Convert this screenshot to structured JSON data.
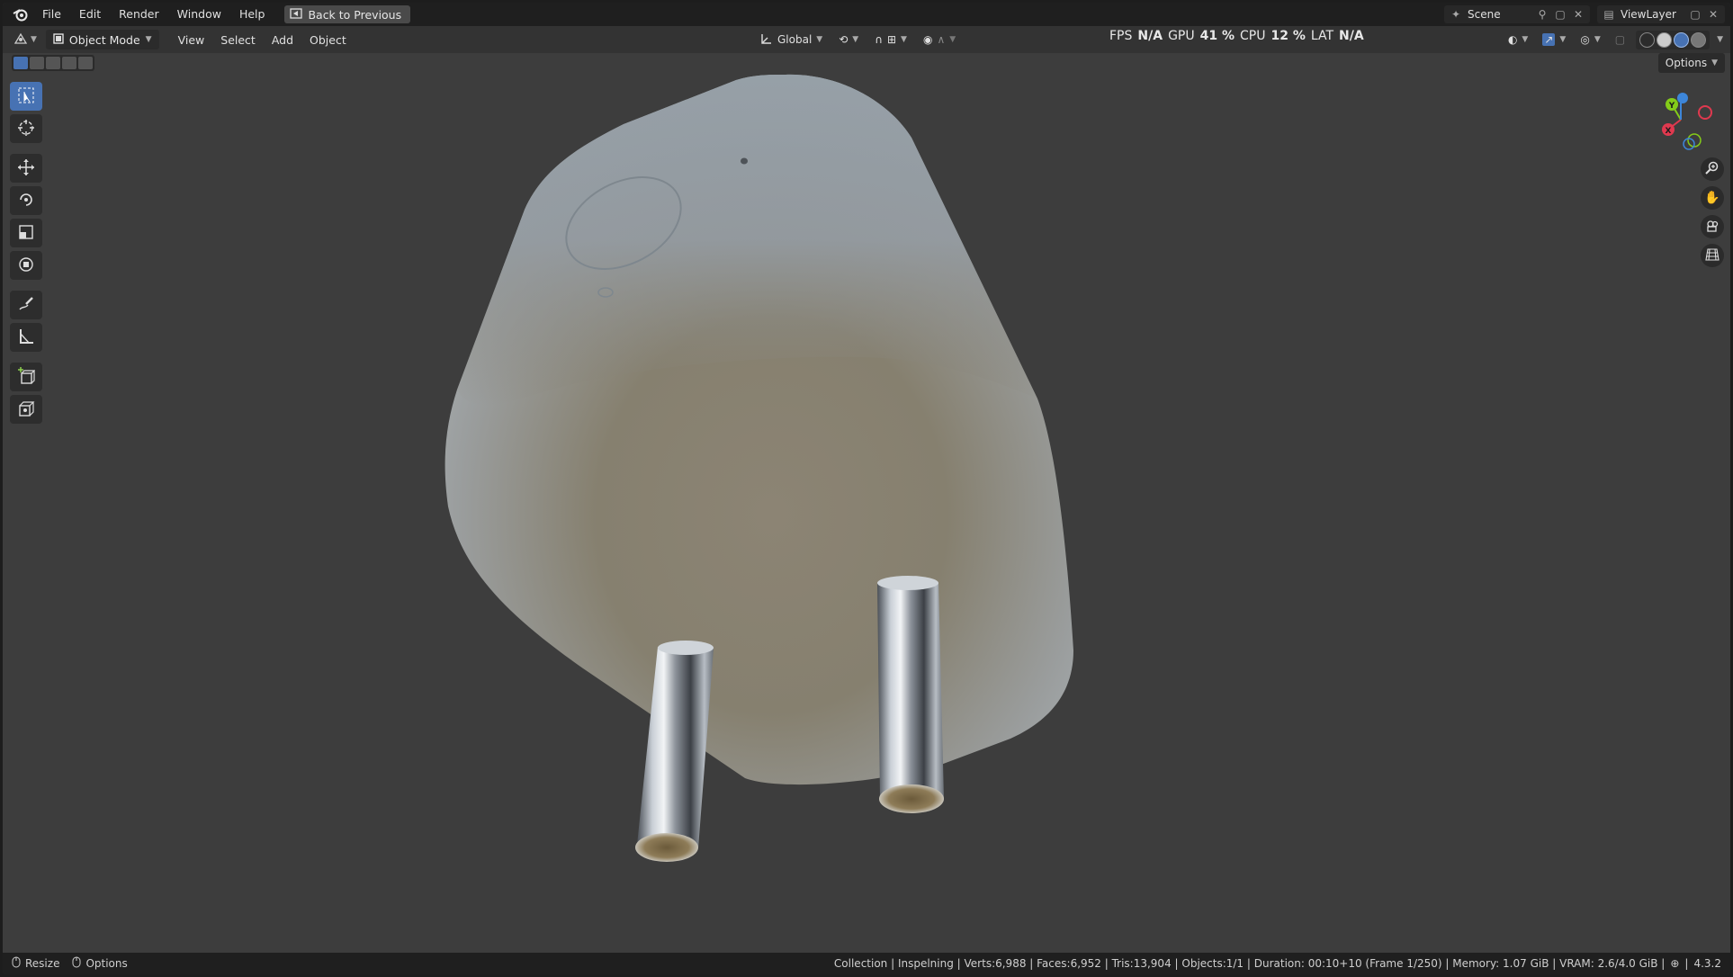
{
  "topbar": {
    "menus": [
      "File",
      "Edit",
      "Render",
      "Window",
      "Help"
    ],
    "back_button": "Back to Previous",
    "scene_name": "Scene",
    "view_layer": "ViewLayer"
  },
  "header": {
    "mode": "Object Mode",
    "menus": [
      "View",
      "Select",
      "Add",
      "Object"
    ],
    "orientation": "Global",
    "options_label": "Options"
  },
  "stats": {
    "fps_label": "FPS",
    "fps_value": "N/A",
    "gpu_label": "GPU",
    "gpu_value": "41 %",
    "cpu_label": "CPU",
    "cpu_value": "12 %",
    "lat_label": "LAT",
    "lat_value": "N/A"
  },
  "gizmo": {
    "x_label": "X",
    "y_label": "Y"
  },
  "statusbar": {
    "left_items": [
      "Resize",
      "Options"
    ],
    "info": "Collection | Inspelning | Verts:6,988 | Faces:6,952 | Tris:13,904 | Objects:1/1 | Duration: 00:10+10 (Frame 1/250) | Memory: 1.07 GiB | VRAM: 2.6/4.0 GiB |",
    "version": "4.3.2"
  },
  "colors": {
    "accent": "#4772b3",
    "viewport_bg": "#3d3d3d",
    "axis_x": "#e0394f",
    "axis_y": "#84cc19",
    "axis_z": "#3d86d9"
  }
}
